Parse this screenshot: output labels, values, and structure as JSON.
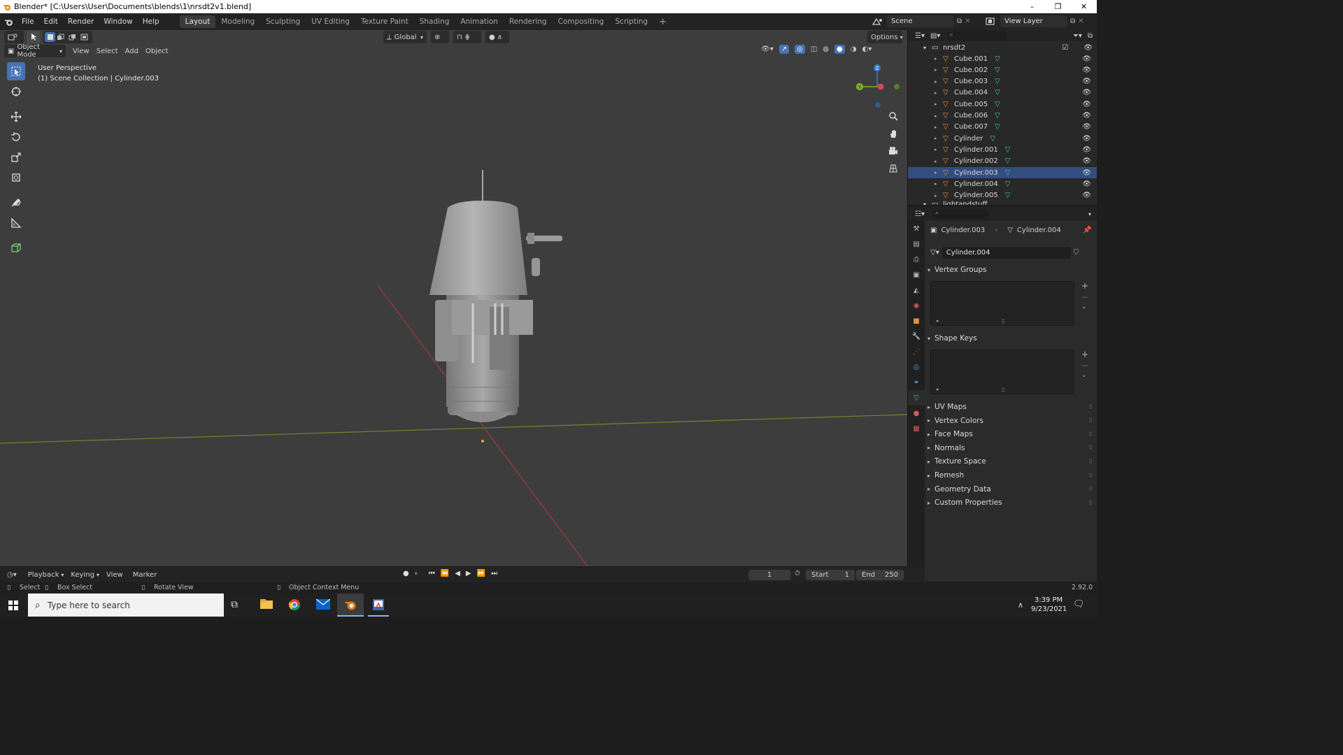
{
  "window": {
    "title": "Blender* [C:\\Users\\User\\Documents\\blends\\1\\nrsdt2v1.blend]",
    "minimize": "–",
    "maximize": "❐",
    "close": "✕"
  },
  "menu": [
    "File",
    "Edit",
    "Render",
    "Window",
    "Help"
  ],
  "workspaces": [
    "Layout",
    "Modeling",
    "Sculpting",
    "UV Editing",
    "Texture Paint",
    "Shading",
    "Animation",
    "Rendering",
    "Compositing",
    "Scripting"
  ],
  "active_workspace": "Layout",
  "scene": {
    "name": "Scene",
    "view_layer": "View Layer"
  },
  "viewport": {
    "mode": "Object Mode",
    "menus": [
      "View",
      "Select",
      "Add",
      "Object"
    ],
    "transform_orientation": "Global",
    "options_label": "Options",
    "info_line1": "User Perspective",
    "info_line2": "(1) Scene Collection | Cylinder.003",
    "gizmo": {
      "z": "Z",
      "y": "Y"
    }
  },
  "outliner": {
    "collection": "nrsdt2",
    "items": [
      "Cube.001",
      "Cube.002",
      "Cube.003",
      "Cube.004",
      "Cube.005",
      "Cube.006",
      "Cube.007",
      "Cylinder",
      "Cylinder.001",
      "Cylinder.002",
      "Cylinder.003",
      "Cylinder.004",
      "Cylinder.005"
    ],
    "next_collection": "lightandstuff"
  },
  "properties": {
    "object_name": "Cylinder.003",
    "mesh_name": "Cylinder.004",
    "datablock": "Cylinder.004",
    "vertex_groups": "Vertex Groups",
    "shape_keys": "Shape Keys",
    "collapsed_panels": [
      "UV Maps",
      "Vertex Colors",
      "Face Maps",
      "Normals",
      "Texture Space",
      "Remesh",
      "Geometry Data",
      "Custom Properties"
    ]
  },
  "timeline": {
    "menus": [
      "Playback",
      "Keying",
      "View",
      "Marker"
    ],
    "current_frame": "1",
    "start_label": "Start",
    "start": "1",
    "end_label": "End",
    "end": "250"
  },
  "statusbar": {
    "select": "Select",
    "box_select": "Box Select",
    "rotate_view": "Rotate View",
    "context_menu": "Object Context Menu",
    "version": "2.92.0"
  },
  "taskbar": {
    "search_placeholder": "Type here to search",
    "time": "3:39 PM",
    "date": "9/23/2021"
  },
  "colors": {
    "accent": "#4772b3",
    "selected_row": "#334d80",
    "mesh_icon": "#3fc499",
    "object_icon": "#e8903a"
  }
}
